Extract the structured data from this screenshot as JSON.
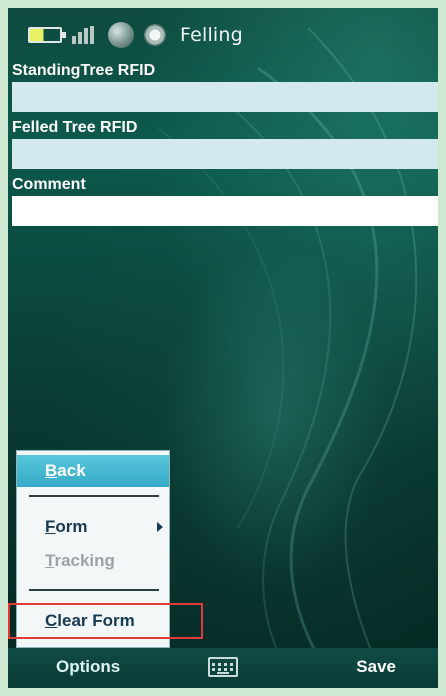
{
  "status_bar": {
    "title": "Felling",
    "icons": [
      "battery-icon",
      "signal-icon",
      "connection-icon",
      "sync-icon"
    ]
  },
  "form": {
    "fields": [
      {
        "label": "StandingTree RFID",
        "value": ""
      },
      {
        "label": "Felled Tree RFID",
        "value": ""
      },
      {
        "label": "Comment",
        "value": ""
      }
    ]
  },
  "menu": {
    "items": [
      {
        "label_first": "B",
        "label_rest": "ack",
        "state": "selected"
      },
      {
        "label_first": "F",
        "label_rest": "orm",
        "state": "normal",
        "has_submenu": true
      },
      {
        "label_first": "T",
        "label_rest": "racking",
        "state": "disabled"
      },
      {
        "label_first": "C",
        "label_rest": "lear Form",
        "state": "normal"
      }
    ]
  },
  "softkeys": {
    "left": "Options",
    "right": "Save",
    "center_icon": "keyboard-icon"
  },
  "colors": {
    "menu_selected": "#35aac7",
    "highlight_box": "#e03a3a",
    "input_bg": "#d4e9ee"
  }
}
